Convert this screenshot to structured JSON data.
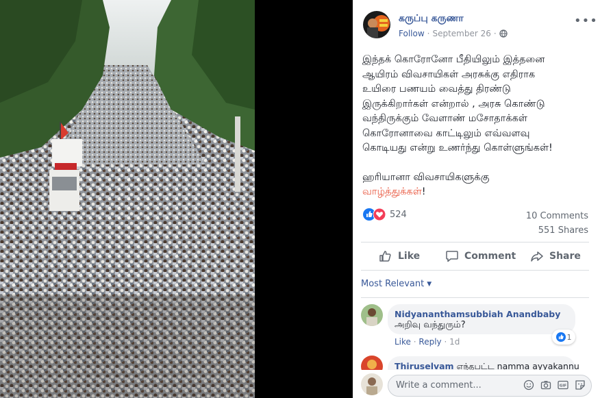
{
  "post": {
    "author": "கருப்பு கருணா",
    "follow_label": "Follow",
    "separator": "·",
    "date": "September 26",
    "text_lines": [
      "இந்தக் கொரோனோ பீதியிலும் இத்தனை",
      "ஆயிரம் விவசாயிகள் அரசுக்கு எதிராக",
      "உயிரை பணயம் வைத்து திரண்டு",
      "இருக்கிறார்கள் என்றால் , அரசு கொண்டு",
      "வந்திருக்கும் வேளாண் மசோதாக்கள்",
      "கொரோனாவை காட்டிலும் எவ்வளவு",
      "கொடியது என்று உணர்ந்து கொள்ளுங்கள்!"
    ],
    "closing_line": "ஹரியானா விவசாயிகளுக்கு",
    "highlight_word": "வாழ்த்துக்கள்",
    "highlight_suffix": "!",
    "reaction_count": "524",
    "comments_count": "10 Comments",
    "shares_count": "551 Shares"
  },
  "actions": {
    "like": "Like",
    "comment": "Comment",
    "share": "Share"
  },
  "sort": {
    "label": "Most Relevant"
  },
  "comments": [
    {
      "author": "Nidyananthamsubbiah Anandbaby",
      "text": "அறிவு வந்துரும்?",
      "like": "Like",
      "reply": "Reply",
      "dot": "·",
      "time": "1d",
      "reactions": "1"
    },
    {
      "author": "Thiruselvam",
      "text": "எந்தபட்ட namma ayyakannu"
    }
  ],
  "composer": {
    "placeholder": "Write a comment..."
  },
  "colors": {
    "link": "#385898",
    "highlight": "#e9573f",
    "like_blue": "#1877f2",
    "love_red": "#f33e58"
  }
}
